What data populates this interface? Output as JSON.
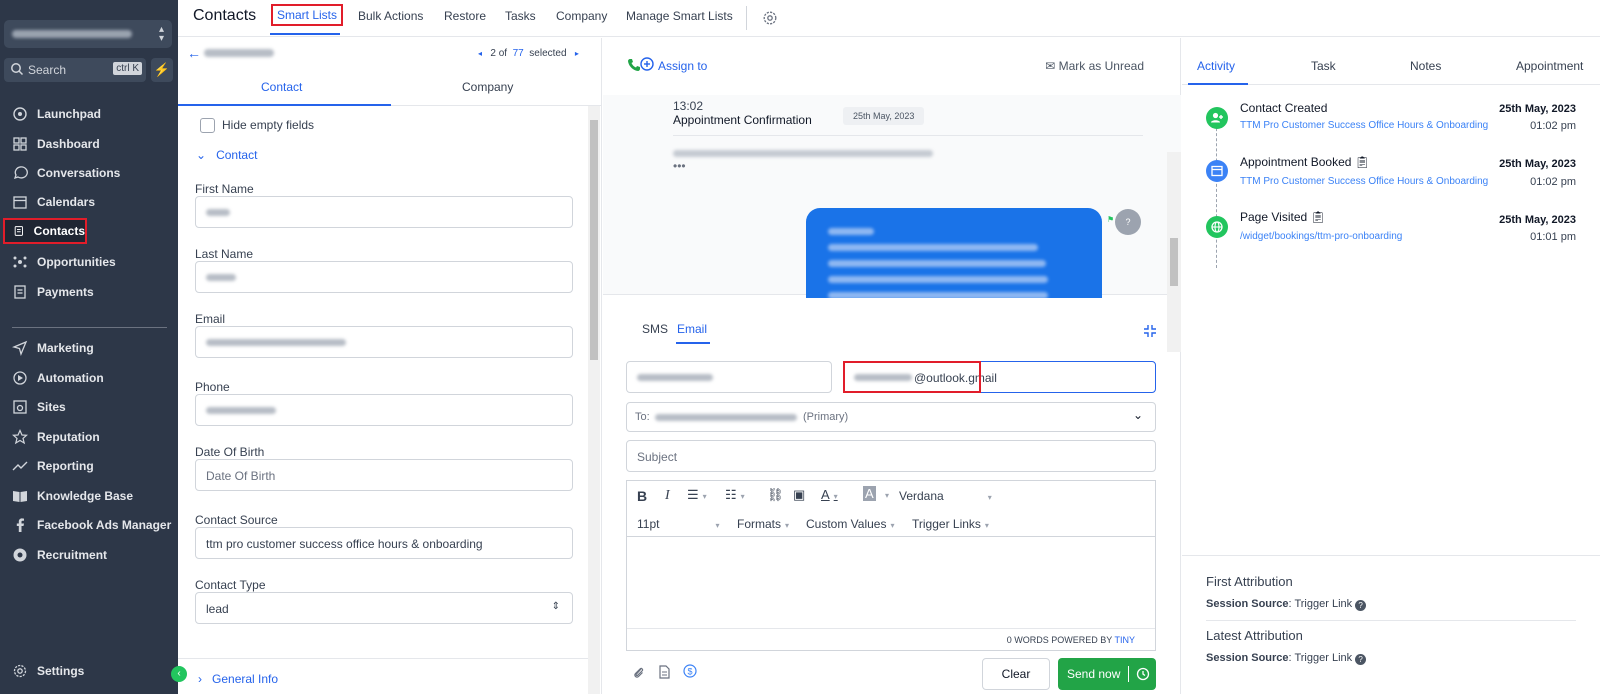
{
  "sidebar": {
    "search_label": "Search",
    "search_shortcut": "ctrl K",
    "items": [
      {
        "label": "Launchpad",
        "icon": "launchpad-icon"
      },
      {
        "label": "Dashboard",
        "icon": "dashboard-icon"
      },
      {
        "label": "Conversations",
        "icon": "chat-icon"
      },
      {
        "label": "Calendars",
        "icon": "calendar-icon"
      },
      {
        "label": "Contacts",
        "icon": "contacts-icon"
      },
      {
        "label": "Opportunities",
        "icon": "opportunities-icon"
      },
      {
        "label": "Payments",
        "icon": "payments-icon"
      },
      {
        "label": "Marketing",
        "icon": "send-icon"
      },
      {
        "label": "Automation",
        "icon": "automation-icon"
      },
      {
        "label": "Sites",
        "icon": "sites-icon"
      },
      {
        "label": "Reputation",
        "icon": "star-icon"
      },
      {
        "label": "Reporting",
        "icon": "trend-icon"
      },
      {
        "label": "Knowledge Base",
        "icon": "book-icon"
      },
      {
        "label": "Facebook Ads Manager",
        "icon": "facebook-icon"
      },
      {
        "label": "Recruitment",
        "icon": "recruitment-icon"
      }
    ],
    "settings_label": "Settings"
  },
  "topbar": {
    "title": "Contacts",
    "tabs": [
      "Smart Lists",
      "Bulk Actions",
      "Restore",
      "Tasks",
      "Company",
      "Manage Smart Lists"
    ]
  },
  "contact_panel": {
    "pager_current": "2 of",
    "pager_total": "77",
    "pager_selected": "selected",
    "tabs": [
      "Contact",
      "Company"
    ],
    "hide_empty": "Hide empty fields",
    "section": "Contact",
    "fields": {
      "first_name": "First Name",
      "last_name": "Last Name",
      "email": "Email",
      "phone": "Phone",
      "dob": "Date Of Birth",
      "dob_placeholder": "Date Of Birth",
      "source": "Contact Source",
      "source_value": "ttm pro customer success office hours & onboarding",
      "type": "Contact Type",
      "type_value": "lead"
    },
    "general_info": "General Info"
  },
  "conversation": {
    "assign": "Assign to",
    "mark_unread": "Mark as Unread",
    "time": "13:02",
    "message_title": "Appointment Confirmation",
    "message_date": "25th May, 2023",
    "dots": "•••",
    "avatar_label": "?"
  },
  "composer": {
    "tabs": [
      "SMS",
      "Email"
    ],
    "from_email_suffix": "@outlook.gmail",
    "to_prefix": "To:",
    "to_primary": "(Primary)",
    "subject_placeholder": "Subject",
    "font": "Verdana",
    "font_size": "11pt",
    "formats": "Formats",
    "custom_values": "Custom Values",
    "trigger_links": "Trigger Links",
    "footer_words": "0 WORDS POWERED BY",
    "footer_tiny": "TINY",
    "clear": "Clear",
    "send": "Send now"
  },
  "activity_panel": {
    "tabs": [
      "Activity",
      "Task",
      "Notes",
      "Appointment"
    ],
    "events": [
      {
        "title": "Contact Created",
        "sub": "TTM Pro Customer Success Office Hours & Onboarding",
        "date": "25th May, 2023",
        "time": "01:02 pm",
        "color": "#22c55e"
      },
      {
        "title": "Appointment Booked",
        "sub": "TTM Pro Customer Success Office Hours & Onboarding",
        "date": "25th May, 2023",
        "time": "01:02 pm",
        "color": "#3b82f6"
      },
      {
        "title": "Page Visited",
        "sub": "/widget/bookings/ttm-pro-onboarding",
        "date": "25th May, 2023",
        "time": "01:01 pm",
        "color": "#22c55e"
      }
    ],
    "first_attribution": "First Attribution",
    "latest_attribution": "Latest Attribution",
    "session_source_label": "Session Source",
    "session_source_value": ": Trigger Link"
  }
}
